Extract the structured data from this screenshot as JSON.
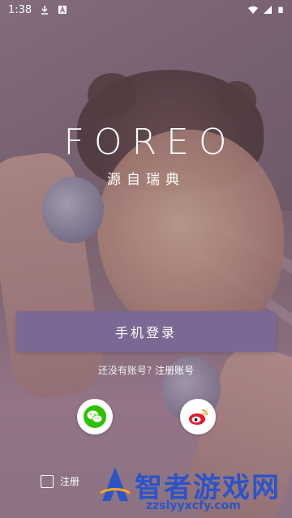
{
  "status_bar": {
    "time": "1:38",
    "icons": [
      "download-icon",
      "a-badge-icon",
      "wifi-icon",
      "signal-icon",
      "battery-icon"
    ]
  },
  "logo": {
    "brand": "FOREO",
    "tagline": "源自瑞典"
  },
  "login": {
    "phone_login_label": "手机登录"
  },
  "register": {
    "prompt": "还没有账号?",
    "link": "注册账号"
  },
  "social": {
    "wechat_icon": "wechat-icon",
    "weibo_icon": "weibo-icon"
  },
  "agreement": {
    "text": "注册"
  },
  "watermark": {
    "title": "智者游戏网",
    "url": "zzslyyxcfy.com"
  },
  "colors": {
    "accent": "#7c6894",
    "watermark": "#2b54c9"
  }
}
